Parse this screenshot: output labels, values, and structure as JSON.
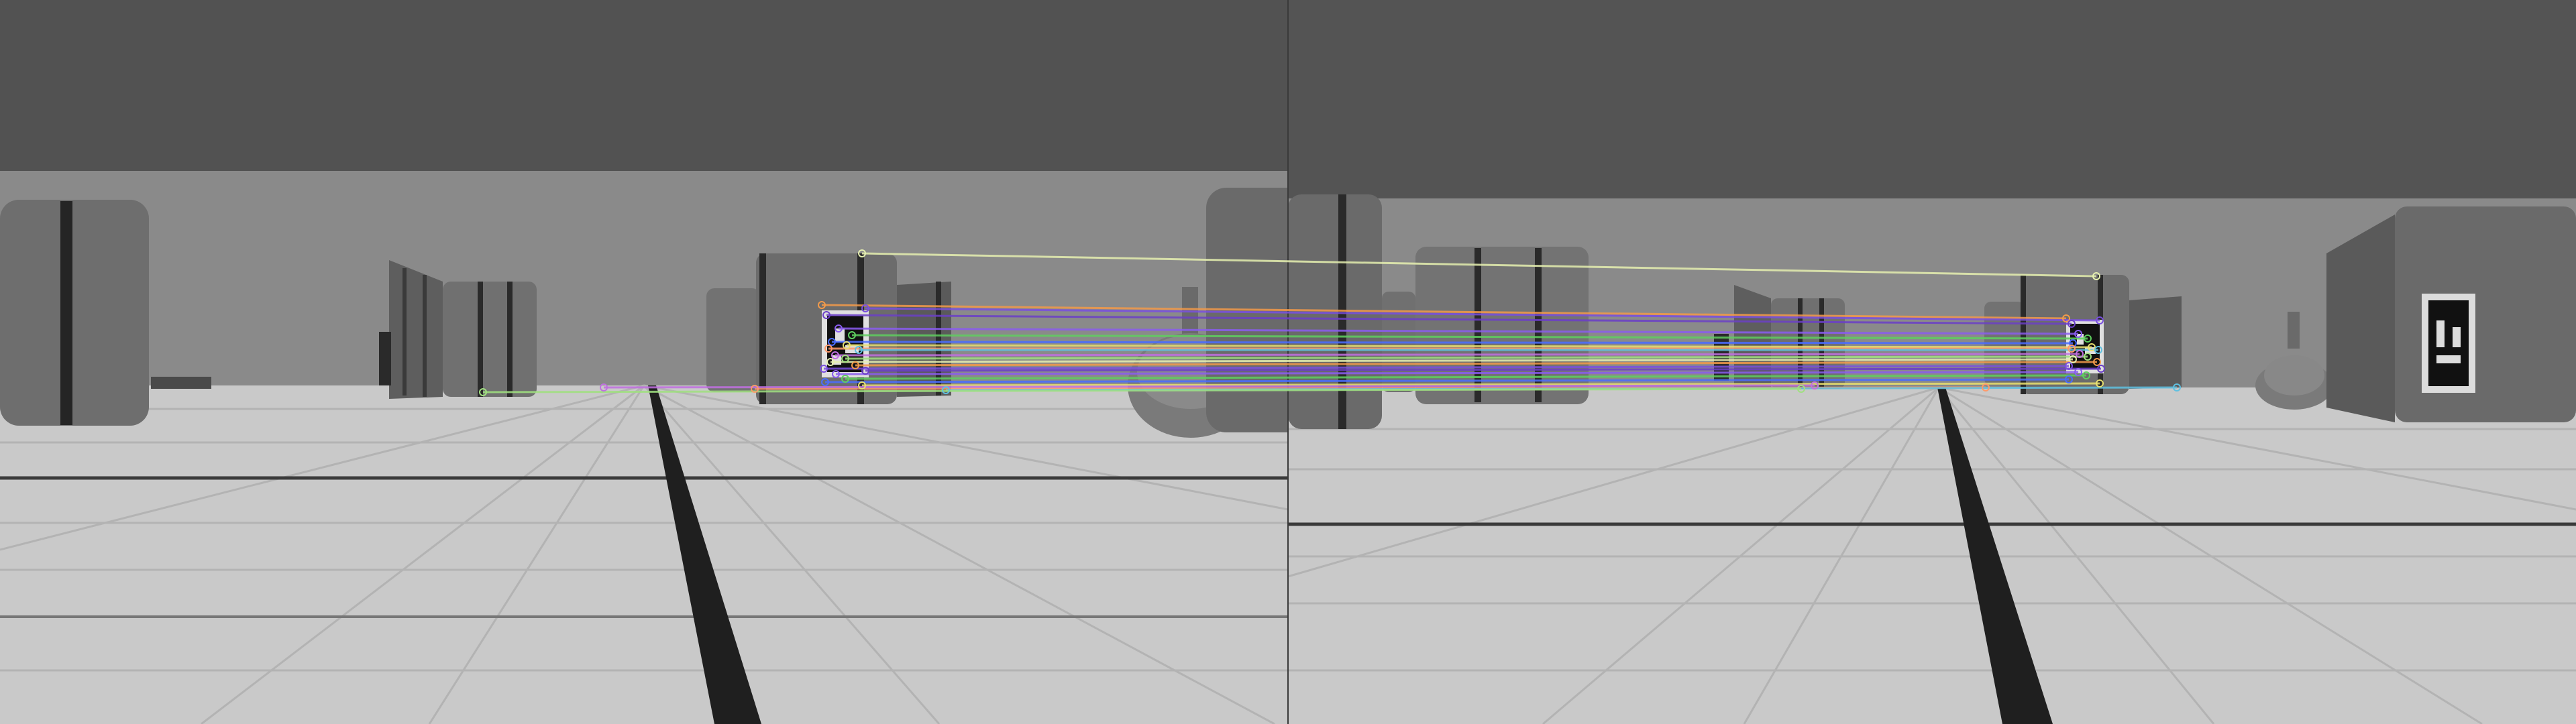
{
  "views": [
    {
      "name": "left-view"
    },
    {
      "name": "right-view"
    }
  ],
  "colors": {
    "sky": "#525252",
    "wall": "#8a8a8a",
    "floor": "#c8c8c8",
    "tile_line": "#b2b2b2",
    "stripe": "#2b2b2b",
    "box_dark": "#4a4a4a",
    "box_mid": "#6b6b6b",
    "box_light": "#7d7d7d",
    "vase": "#7a7a7a"
  },
  "match_colors": [
    "#e6f0b0",
    "#f29a4a",
    "#7a4fe0",
    "#6b3fc8",
    "#8a5cf0",
    "#5fd05f",
    "#4a6cff",
    "#e8e070",
    "#ff9a6a",
    "#60c0e0",
    "#c070e0",
    "#a0e080"
  ],
  "match_count": 24
}
